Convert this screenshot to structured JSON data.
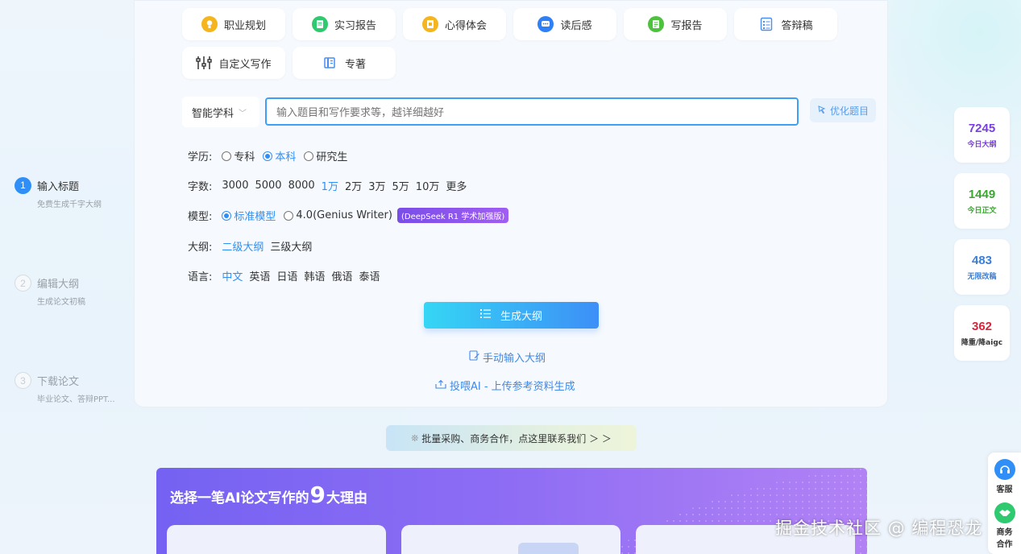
{
  "categories": [
    {
      "label": "职业规划",
      "icon": "lightbulb-icon",
      "color": "#f5b51f"
    },
    {
      "label": "实习报告",
      "icon": "document-icon",
      "color": "#2fc96f"
    },
    {
      "label": "心得体会",
      "icon": "notes-icon",
      "color": "#f5b51f"
    },
    {
      "label": "读后感",
      "icon": "chat-icon",
      "color": "#2f7ff6"
    },
    {
      "label": "写报告",
      "icon": "report-icon",
      "color": "#4ec23f"
    },
    {
      "label": "答辩稿",
      "icon": "checklist-icon",
      "color": "#4a8ef0"
    },
    {
      "label": "自定义写作",
      "icon": "sliders-icon",
      "color": "#333333"
    },
    {
      "label": "专著",
      "icon": "book-icon",
      "color": "#4a8ef0"
    }
  ],
  "subject": {
    "selected": "智能学科"
  },
  "topic_input": {
    "placeholder": "输入题目和写作要求等，越详细越好"
  },
  "optimize_label": "优化题目",
  "education": {
    "label": "学历:",
    "options": [
      "专科",
      "本科",
      "研究生"
    ],
    "selected": "本科"
  },
  "wordcount": {
    "label": "字数:",
    "options": [
      "3000",
      "5000",
      "8000",
      "1万",
      "2万",
      "3万",
      "5万",
      "10万",
      "更多"
    ],
    "selected": "1万"
  },
  "model": {
    "label": "模型:",
    "options": [
      "标准模型",
      "4.0(Genius Writer)"
    ],
    "selected": "标准模型",
    "badge": "(DeepSeek R1 学术加强版)"
  },
  "outline": {
    "label": "大纲:",
    "options": [
      "二级大纲",
      "三级大纲"
    ],
    "selected": "二级大纲"
  },
  "language": {
    "label": "语言:",
    "options": [
      "中文",
      "英语",
      "日语",
      "韩语",
      "俄语",
      "泰语"
    ],
    "selected": "中文"
  },
  "generate_label": "生成大纲",
  "manual_label": "手动输入大纲",
  "upload_label": "投喂AI - 上传参考资料生成",
  "steps": [
    {
      "num": "1",
      "title": "输入标题",
      "sub": "免费生成千字大纲"
    },
    {
      "num": "2",
      "title": "编辑大纲",
      "sub": "生成论文初稿"
    },
    {
      "num": "3",
      "title": "下载论文",
      "sub": "毕业论文、答辩PPT..."
    }
  ],
  "promo_label": "批量采购、商务合作，点这里联系我们 ＞ ＞",
  "reasons": {
    "pre": "选择一笔AI论文写作的",
    "num": "9",
    "post": "大理由"
  },
  "stats": [
    {
      "value": "7245",
      "label": "今日大纲",
      "color": "#7a3fe0"
    },
    {
      "value": "1449",
      "label": "今日正文",
      "color": "#3aa82f"
    },
    {
      "value": "483",
      "label": "无限改稿",
      "color": "#3a7fd8"
    },
    {
      "value": "362",
      "label": "降重/降aigc",
      "color": "#d7263d"
    }
  ],
  "float": {
    "service": "客服",
    "business_1": "商务",
    "business_2": "合作"
  },
  "watermark": "掘金技术社区 @ 编程恐龙"
}
